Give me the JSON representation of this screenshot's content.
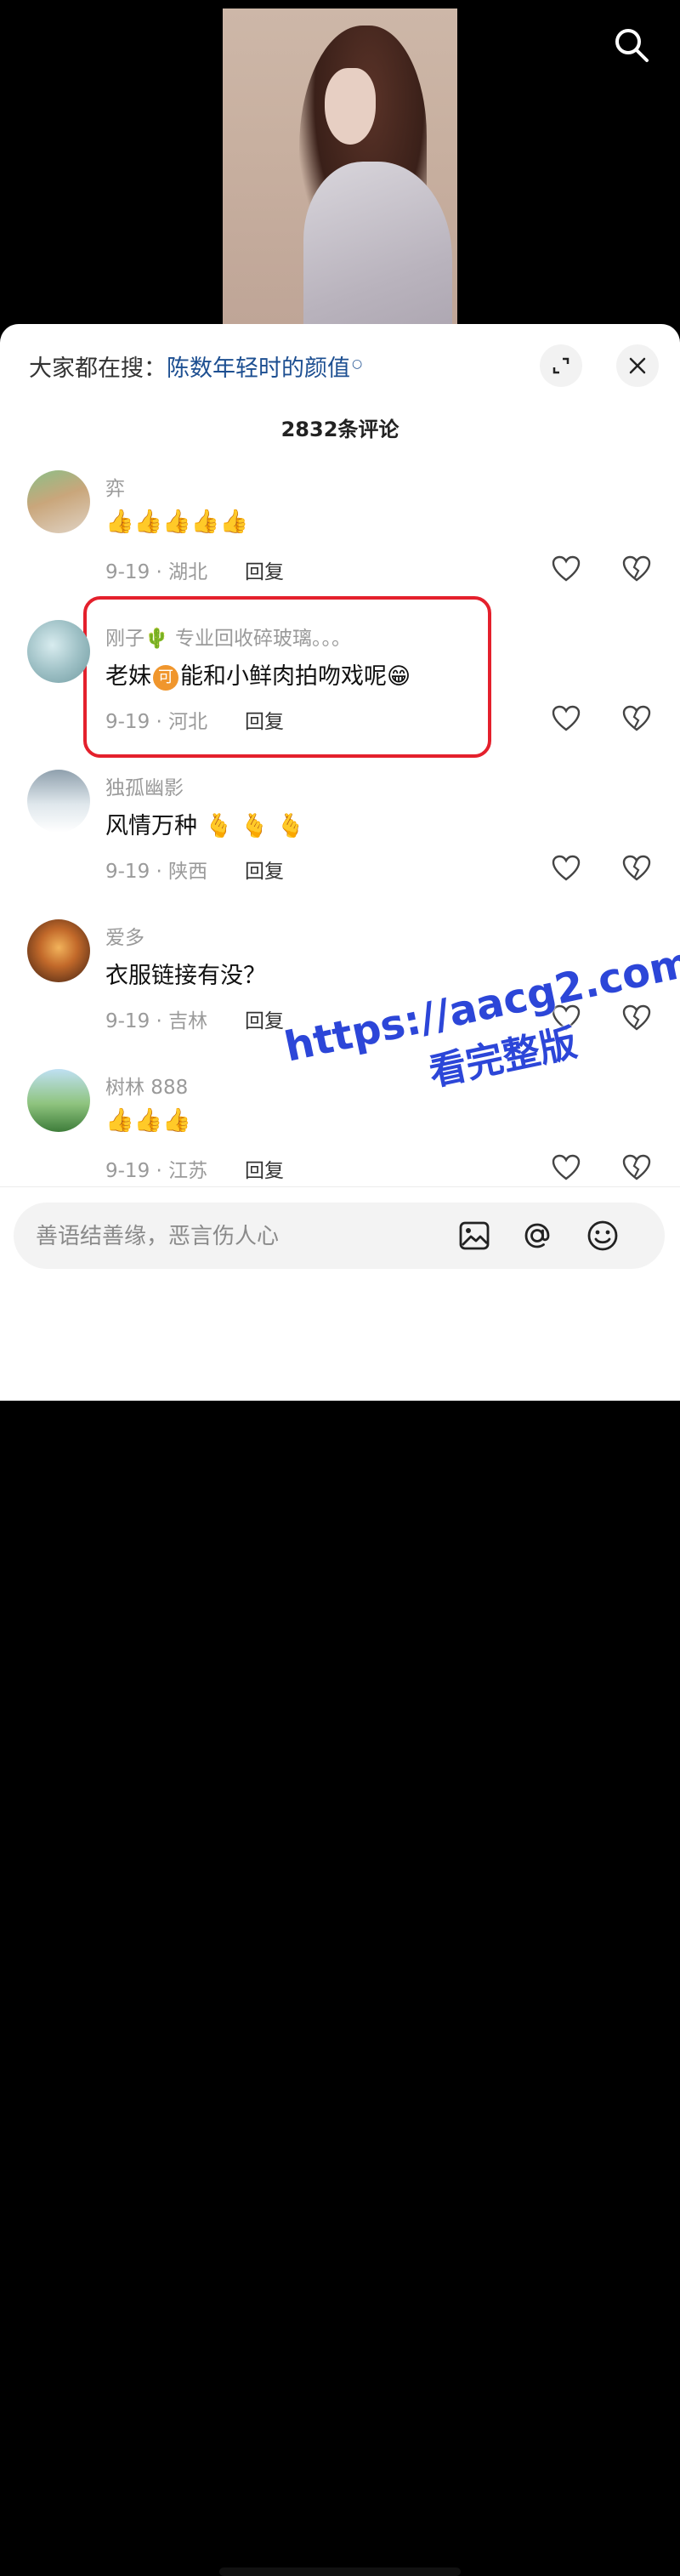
{
  "hot_search": {
    "prefix": "大家都在搜：",
    "query": "陈数年轻时的颜值"
  },
  "comment_count": "2832条评论",
  "comments": [
    {
      "name": "弈",
      "text_parts": [
        "👍👍👍👍👍"
      ],
      "date_location": "9-19 · 湖北",
      "reply": "回复"
    },
    {
      "name": "刚子🌵 专业回收碎玻璃。。。",
      "text_before": "老妹",
      "badge": "可",
      "text_after": "能和小鲜肉拍吻戏呢😁",
      "date_location": "9-19 · 河北",
      "reply": "回复",
      "highlighted": true
    },
    {
      "name": "独孤幽影",
      "text_parts": [
        "风情万种 🫰 🫰 🫰"
      ],
      "date_location": "9-19 · 陕西",
      "reply": "回复"
    },
    {
      "name": "爱多",
      "text_parts": [
        "衣服链接有没？"
      ],
      "date_location": "9-19 · 吉林",
      "reply": "回复"
    },
    {
      "name": "树林 888",
      "text_parts": [
        "👍👍👍"
      ],
      "date_location": "9-19 · 江苏",
      "reply": "回复"
    }
  ],
  "input": {
    "placeholder": "善语结善缘，恶言伤人心"
  },
  "watermark": {
    "line1": "https://aacg2.com",
    "line2": "看完整版"
  },
  "colors": {
    "highlight_border": "#e4202c",
    "query_link": "#1d4f91",
    "watermark": "#2c46d8",
    "badge": "#f0962d"
  },
  "icons": [
    "search-icon",
    "expand-icon",
    "close-icon",
    "heart-icon",
    "broken-heart-icon",
    "image-icon",
    "at-icon",
    "emoji-icon"
  ]
}
